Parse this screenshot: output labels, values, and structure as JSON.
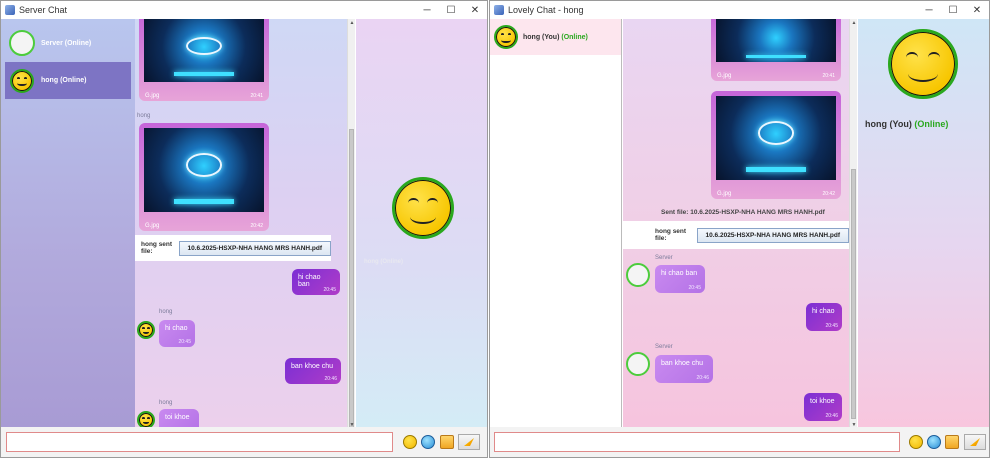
{
  "left_window": {
    "title": "Server Chat",
    "contacts": [
      {
        "name": "Server",
        "status": "(Online)"
      },
      {
        "name": "hong",
        "status": "(Online)"
      }
    ],
    "messages": {
      "img1": {
        "file": "G.jpg",
        "time": "20:41"
      },
      "img2_sender": "hong",
      "img2": {
        "file": "G.jpg",
        "time": "20:42"
      },
      "file_label": "hong sent file:",
      "file_name": "10.6.2025-HSXP-NHA HANG MRS HANH.pdf",
      "out1": {
        "text": "hi chao ban",
        "time": "20:45"
      },
      "in1_sender": "hong",
      "in1": {
        "text": "hi chao",
        "time": "20:45"
      },
      "out2": {
        "text": "ban khoe chu",
        "time": "20:46"
      },
      "in2_sender": "hong",
      "in2": {
        "text": "toi khoe",
        "time": ""
      }
    },
    "profile": {
      "name": "hong",
      "status": "(Online)"
    },
    "input_value": ""
  },
  "right_window": {
    "title": "Lovely Chat - hong",
    "contact": {
      "name": "hong (You)",
      "status": "(Online)"
    },
    "messages": {
      "img1": {
        "file": "G.jpg",
        "time": "20:41"
      },
      "img2": {
        "file": "G.jpg",
        "time": "20:42"
      },
      "sent_file_text": "Sent file: 10.6.2025-HSXP-NHA HANG MRS HANH.pdf",
      "file_label": "hong sent file:",
      "file_name": "10.6.2025-HSXP-NHA HANG MRS HANH.pdf",
      "in1_sender": "Server",
      "in1": {
        "text": "hi chao ban",
        "time": "20:45"
      },
      "out1": {
        "text": "hi chao",
        "time": "20:45"
      },
      "in2_sender": "Server",
      "in2": {
        "text": "ban khoe chu",
        "time": "20:46"
      },
      "out2": {
        "text": "toi khoe",
        "time": "20:46"
      }
    },
    "profile": {
      "name": "hong (You)",
      "status": "(Online)"
    },
    "input_value": ""
  },
  "icons": [
    "app-icon",
    "minimize-icon",
    "maximize-icon",
    "close-icon",
    "emoji-icon",
    "image-icon",
    "folder-icon",
    "send-icon",
    "avatar-smiley-icon"
  ],
  "colors": {
    "online": "#2aa81e",
    "bubble_out": "#7b2fd4",
    "bubble_in": "#c98af0",
    "selected_contact": "#7d74c4"
  }
}
